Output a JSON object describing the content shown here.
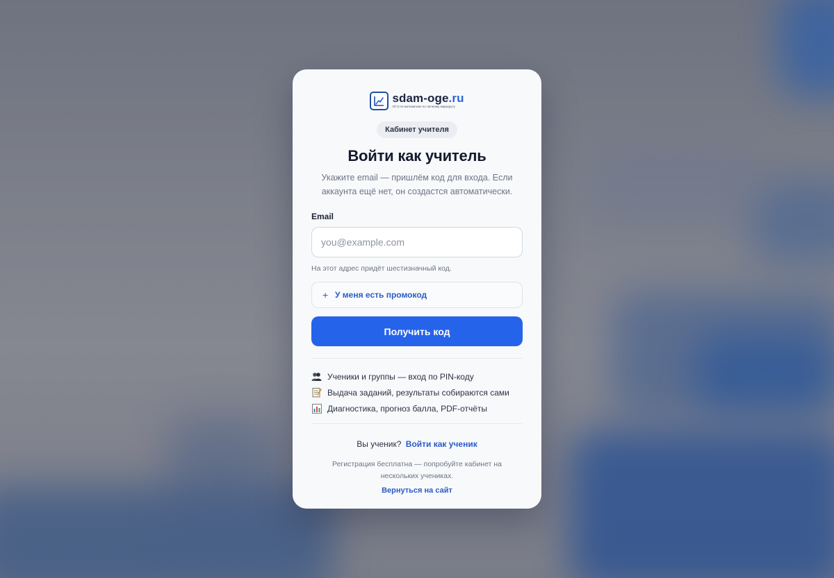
{
  "brand": {
    "name_main": "sdam-oge",
    "name_tld": ".ru",
    "tagline": "ОГЭ по математике по личному маршруту",
    "accent": "#2563eb"
  },
  "badge": "Кабинет учителя",
  "title": "Войти как учитель",
  "subtitle": "Укажите email — пришлём код для входа. Если аккаунта ещё нет, он создастся автоматически.",
  "form": {
    "email_label": "Email",
    "email_value": "",
    "email_placeholder": "you@example.com",
    "email_hint": "На этот адрес придёт шестизначный код.",
    "promo_icon": "+",
    "promo_label": "У меня есть промокод",
    "submit_label": "Получить код"
  },
  "features": [
    {
      "icon": "people-icon",
      "text": "Ученики и группы — вход по PIN-коду"
    },
    {
      "icon": "memo-icon",
      "text": "Выдача заданий, результаты собираются сами"
    },
    {
      "icon": "bar-chart-icon",
      "text": "Диагностика, прогноз балла, PDF-отчёты"
    }
  ],
  "footer": {
    "student_question": "Вы ученик?",
    "student_link": "Войти как ученик",
    "note": "Регистрация бесплатна — попробуйте кабинет на нескольких учениках.",
    "back_link": "Вернуться на сайт"
  }
}
